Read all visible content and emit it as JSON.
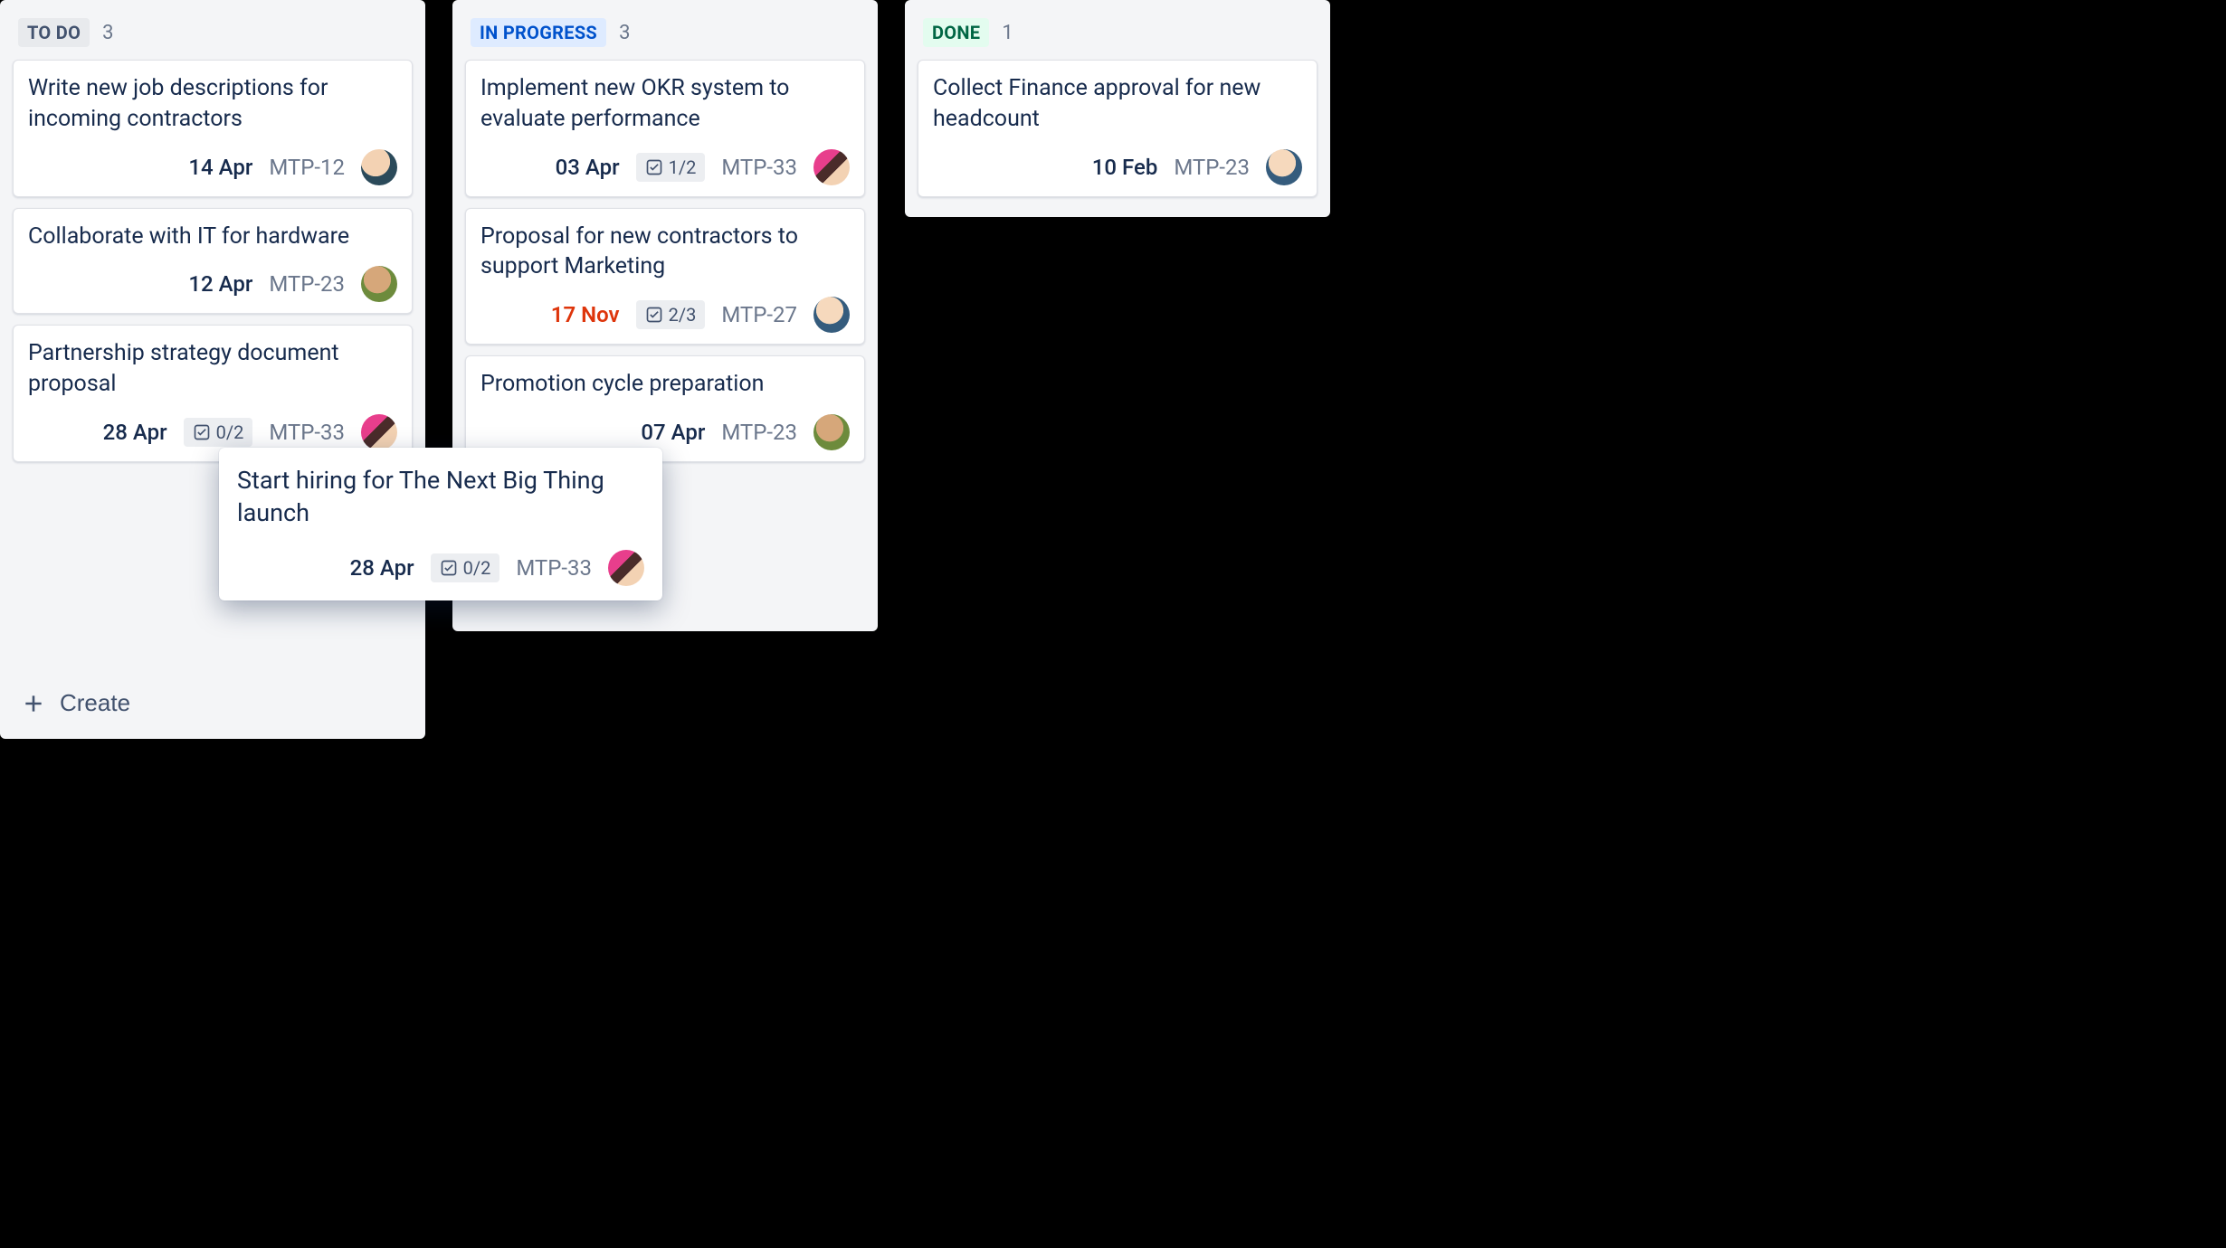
{
  "create_label": "Create",
  "columns": [
    {
      "id": "todo",
      "title": "TO DO",
      "count": "3",
      "cards": [
        {
          "title": "Write new job descriptions for incoming contractors",
          "date": "14 Apr",
          "ticket": "MTP-12",
          "avatar": "av1"
        },
        {
          "title": "Collaborate with IT for hardware",
          "date": "12 Apr",
          "ticket": "MTP-23",
          "avatar": "av2"
        },
        {
          "title": "Partnership strategy document proposal",
          "date": "28 Apr",
          "ticket": "MTP-33",
          "avatar": "av3",
          "subtasks": "0/2"
        }
      ]
    },
    {
      "id": "inprogress",
      "title": "IN PROGRESS",
      "count": "3",
      "cards": [
        {
          "title": "Implement new OKR system to evaluate performance",
          "date": "03 Apr",
          "ticket": "MTP-33",
          "avatar": "av3",
          "subtasks": "1/2"
        },
        {
          "title": "Proposal for new contractors to support Marketing",
          "date": "17 Nov",
          "overdue": true,
          "ticket": "MTP-27",
          "avatar": "av4",
          "subtasks": "2/3"
        },
        {
          "title": "Promotion cycle preparation",
          "date": "07 Apr",
          "ticket": "MTP-23",
          "avatar": "av2"
        }
      ]
    },
    {
      "id": "done",
      "title": "DONE",
      "count": "1",
      "cards": [
        {
          "title": "Collect Finance approval for new headcount",
          "date": "10 Feb",
          "ticket": "MTP-23",
          "avatar": "av4"
        }
      ]
    }
  ],
  "dragging_card": {
    "title": "Start hiring for The Next Big Thing launch",
    "date": "28 Apr",
    "subtasks": "0/2",
    "ticket": "MTP-33",
    "avatar": "av3"
  }
}
